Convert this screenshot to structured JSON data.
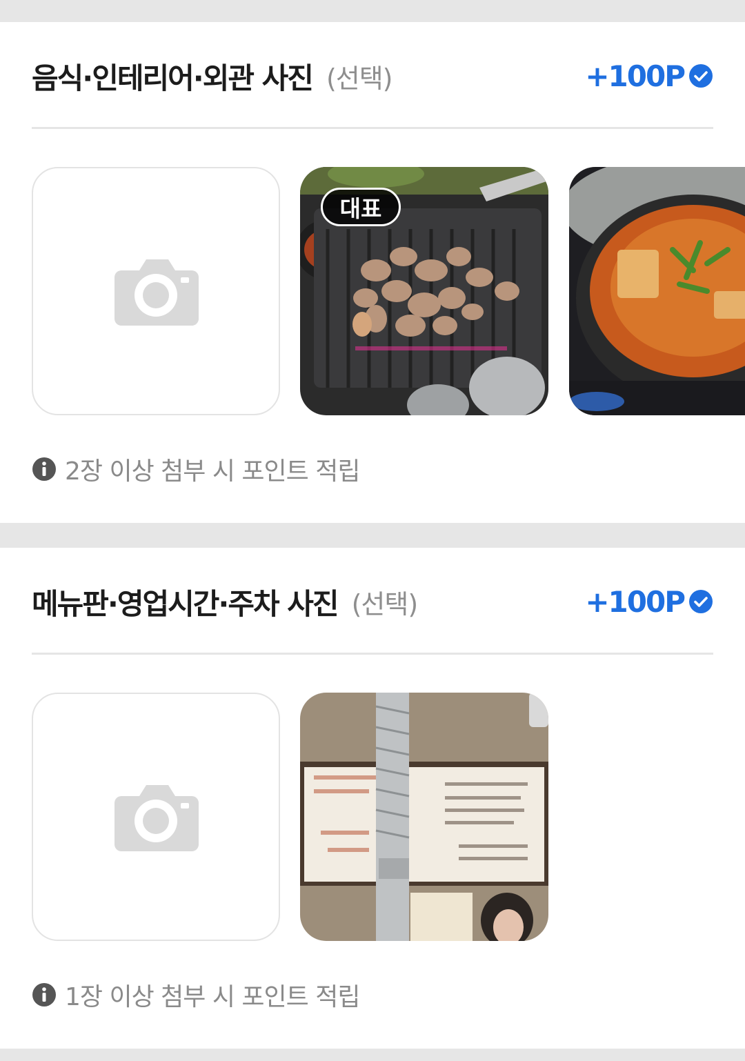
{
  "sections": [
    {
      "title": "음식·인테리어·외관 사진",
      "optional_label": "(선택)",
      "points_label": "+100P",
      "note": "2장 이상 첨부 시 포인트 적립",
      "photos": [
        {
          "badge": "대표",
          "icon": "grilled-pork-photo"
        },
        {
          "icon": "kimchi-stew-photo"
        }
      ]
    },
    {
      "title": "메뉴판·영업시간·주차 사진",
      "optional_label": "(선택)",
      "points_label": "+100P",
      "note": "1장 이상 첨부 시 포인트 적립",
      "photos": [
        {
          "icon": "menu-board-photo"
        }
      ]
    }
  ],
  "icons": {
    "add_photo": "camera-icon",
    "points_check": "check-circle-icon",
    "note": "info-icon"
  },
  "colors": {
    "accent": "#1f6fe0",
    "title": "#1c1c1c",
    "muted": "#8a8a8a",
    "page_bg": "#e6e6e6",
    "placeholder_icon": "#d9d9d9"
  }
}
